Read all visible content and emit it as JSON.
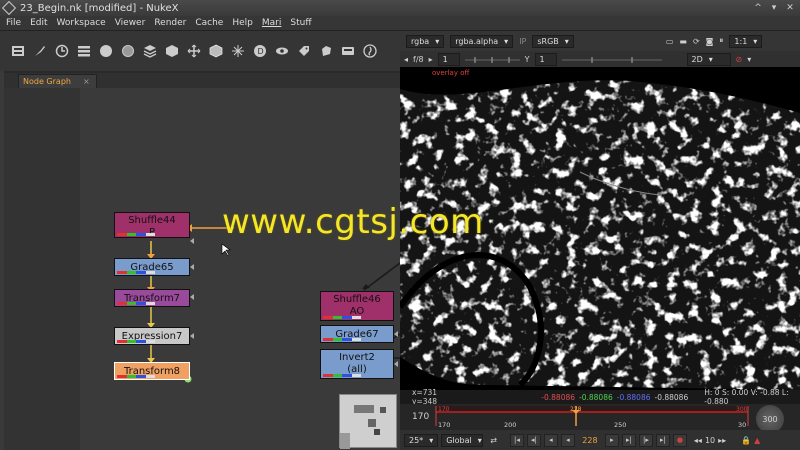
{
  "window": {
    "title": "23_Begin.nk [modified] - NukeX",
    "controls": [
      "^",
      "▾",
      "✕"
    ]
  },
  "menu": [
    "File",
    "Edit",
    "Workspace",
    "Viewer",
    "Render",
    "Cache",
    "Help",
    "Mari",
    "Stuff"
  ],
  "toolbar_icons": [
    "image-icon",
    "brush-icon",
    "clock-icon",
    "channel-icon",
    "color-icon",
    "filter-icon",
    "keyer-icon",
    "merge-icon",
    "transform-icon",
    "3d-icon",
    "particles-icon",
    "deep-icon",
    "views-icon",
    "metadata-icon",
    "toolsets-icon",
    "other-icon",
    "furnace-icon"
  ],
  "tabs": {
    "node_graph": "Node Graph",
    "close": "×"
  },
  "nodes": [
    {
      "id": "shuffle44",
      "label": "Shuffle44",
      "sub": "P"
    },
    {
      "id": "grade65",
      "label": "Grade65"
    },
    {
      "id": "transform7",
      "label": "Transform7"
    },
    {
      "id": "expression7",
      "label": "Expression7"
    },
    {
      "id": "transform8",
      "label": "Transform8"
    },
    {
      "id": "shuffle46",
      "label": "Shuffle46",
      "sub": "AO"
    },
    {
      "id": "grade67",
      "label": "Grade67"
    },
    {
      "id": "invert2",
      "label": "Invert2",
      "sub": "(all)"
    }
  ],
  "viewer": {
    "channels": "rgba",
    "alpha": "rgba.alpha",
    "ip": "IP",
    "lut": "sRGB",
    "zoom": "1:1",
    "fstop": "f/8",
    "gain_value": "1",
    "y_label": "Y",
    "gamma_value": "1",
    "view_mode": "2D",
    "overlay_text": "overlay off"
  },
  "info": {
    "coords": "x=731 y=348",
    "r": "-0.88086",
    "g": "-0.88086",
    "b": "-0.88086",
    "a": "-0.88086",
    "hsvl": "H:  0 S: 0.00 V: -0.88  L: -0.880"
  },
  "timeline": {
    "start": "170",
    "in_mark": "170",
    "current_mark": "228",
    "end_mark": "300",
    "tick_170": "170",
    "tick_200": "200",
    "tick_250": "250",
    "tick_300": "30",
    "end_knob": "300"
  },
  "playback": {
    "fps": "25*",
    "scope": "Global",
    "frame": "228",
    "step": "10"
  },
  "watermark": "www.cgtsj.com"
}
